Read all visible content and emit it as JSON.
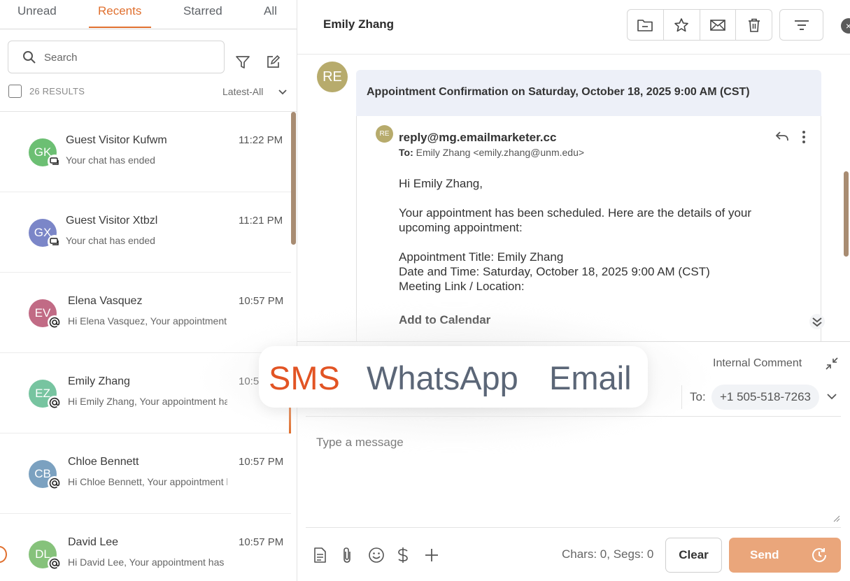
{
  "tabs": {
    "unread": "Unread",
    "recents": "Recents",
    "starred": "Starred",
    "all": "All"
  },
  "search": {
    "placeholder": "Search"
  },
  "results": "26 RESULTS",
  "sort_label": "Latest-All",
  "conversations": [
    {
      "initials": "GK",
      "name": "Guest Visitor Kufwm",
      "time": "11:22 PM",
      "preview": "Your chat has ended",
      "avatar_color": "#6cbf73",
      "channel": "chat"
    },
    {
      "initials": "GX",
      "name": "Guest Visitor Xtbzl",
      "time": "11:21 PM",
      "preview": "Your chat has ended",
      "avatar_color": "#7b86c8",
      "channel": "chat"
    },
    {
      "initials": "EV",
      "name": "Elena Vasquez",
      "time": "10:57 PM",
      "preview": "Hi Elena Vasquez, Your appointment h",
      "avatar_color": "#c16b85",
      "channel": "email"
    },
    {
      "initials": "EZ",
      "name": "Emily Zhang",
      "time": "10:57 PM",
      "preview": "Hi Emily Zhang, Your appointment ha",
      "avatar_color": "#77c4a0",
      "channel": "email"
    },
    {
      "initials": "CB",
      "name": "Chloe Bennett",
      "time": "10:57 PM",
      "preview": "Hi Chloe Bennett, Your appointment h",
      "avatar_color": "#7ba1c0",
      "channel": "email"
    },
    {
      "initials": "DL",
      "name": "David Lee",
      "time": "10:57 PM",
      "preview": "Hi David Lee, Your appointment has b",
      "avatar_color": "#86c27b",
      "channel": "email"
    }
  ],
  "header": {
    "contact_name": "Emily Zhang"
  },
  "email": {
    "thread_avatar": "RE",
    "subject": "Appointment Confirmation on Saturday, October 18, 2025 9:00 AM (CST)",
    "sender_avatar": "RE",
    "from": "reply@mg.emailmarketer.cc",
    "to_label": "To:",
    "to_value": "Emily Zhang <emily.zhang@unm.edu>",
    "greeting": "Hi Emily Zhang,",
    "line1": "Your appointment has been scheduled. Here are the details of your",
    "line2": "upcoming appointment:",
    "title_line": "Appointment Title: Emily Zhang",
    "date_line": "Date and Time: Saturday, October 18, 2025 9:00 AM (CST)",
    "location_line": "Meeting Link / Location:",
    "calendar_link": "Add to Calendar"
  },
  "composer": {
    "internal_comment": "Internal Comment",
    "to_label": "To:",
    "to_phone": "+1 505-518-7263",
    "placeholder": "Type a message",
    "counter": "Chars: 0, Segs: 0",
    "clear_label": "Clear",
    "send_label": "Send"
  },
  "channel_popup": {
    "options": [
      "SMS",
      "WhatsApp",
      "Email"
    ],
    "selected": "SMS"
  },
  "colors": {
    "accent": "#e0702f",
    "send_button": "#eaa67b",
    "subject_bg": "#edf0f8"
  }
}
